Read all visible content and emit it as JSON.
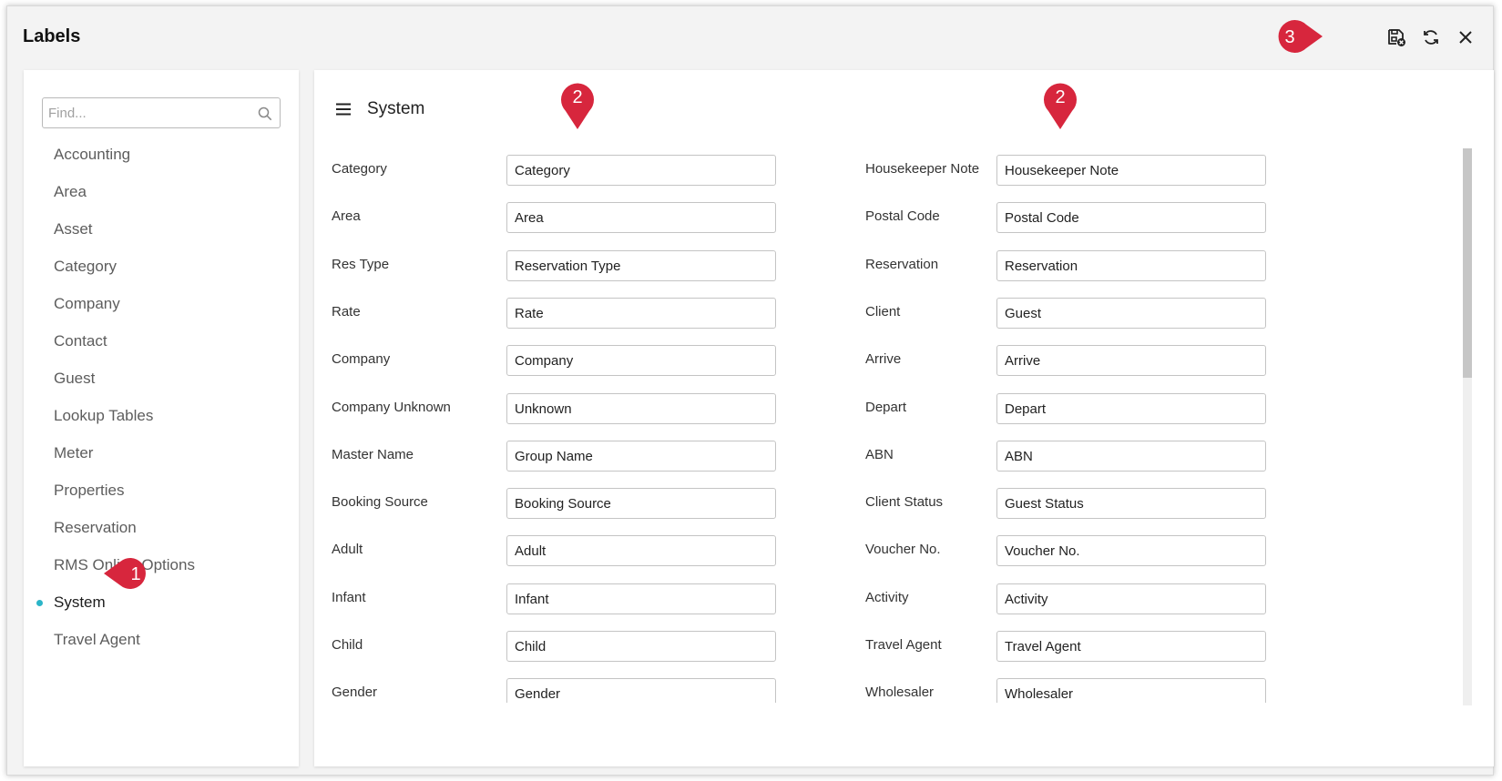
{
  "window": {
    "title": "Labels"
  },
  "toolbar": {
    "save_close_icon": "save-close-icon",
    "refresh_icon": "refresh-icon",
    "close_icon": "close-icon"
  },
  "sidebar": {
    "search_placeholder": "Find...",
    "items": [
      {
        "label": "Accounting"
      },
      {
        "label": "Area"
      },
      {
        "label": "Asset"
      },
      {
        "label": "Category"
      },
      {
        "label": "Company"
      },
      {
        "label": "Contact"
      },
      {
        "label": "Guest"
      },
      {
        "label": "Lookup Tables"
      },
      {
        "label": "Meter"
      },
      {
        "label": "Properties"
      },
      {
        "label": "Reservation"
      },
      {
        "label": "RMS Online Options"
      },
      {
        "label": "System"
      },
      {
        "label": "Travel Agent"
      }
    ],
    "active_item": "System",
    "active_color": "#2bb5c8"
  },
  "main": {
    "title": "System",
    "left_fields": [
      {
        "label": "Category",
        "value": "Category"
      },
      {
        "label": "Area",
        "value": "Area"
      },
      {
        "label": "Res Type",
        "value": "Reservation Type"
      },
      {
        "label": "Rate",
        "value": "Rate"
      },
      {
        "label": "Company",
        "value": "Company"
      },
      {
        "label": "Company Unknown",
        "value": "Unknown"
      },
      {
        "label": "Master Name",
        "value": "Group Name"
      },
      {
        "label": "Booking Source",
        "value": "Booking Source"
      },
      {
        "label": "Adult",
        "value": "Adult"
      },
      {
        "label": "Infant",
        "value": "Infant"
      },
      {
        "label": "Child",
        "value": "Child"
      },
      {
        "label": "Gender",
        "value": "Gender"
      }
    ],
    "right_fields": [
      {
        "label": "Housekeeper Note",
        "value": "Housekeeper Note"
      },
      {
        "label": "Postal Code",
        "value": "Postal Code"
      },
      {
        "label": "Reservation",
        "value": "Reservation"
      },
      {
        "label": "Client",
        "value": "Guest"
      },
      {
        "label": "Arrive",
        "value": "Arrive"
      },
      {
        "label": "Depart",
        "value": "Depart"
      },
      {
        "label": "ABN",
        "value": "ABN"
      },
      {
        "label": "Client Status",
        "value": "Guest Status"
      },
      {
        "label": "Voucher No.",
        "value": "Voucher No."
      },
      {
        "label": "Activity",
        "value": "Activity"
      },
      {
        "label": "Travel Agent",
        "value": "Travel Agent"
      },
      {
        "label": "Wholesaler",
        "value": "Wholesaler"
      }
    ]
  },
  "annotations": {
    "step1": "1",
    "step2a": "2",
    "step2b": "2",
    "step3": "3",
    "marker_color": "#d7263d"
  }
}
